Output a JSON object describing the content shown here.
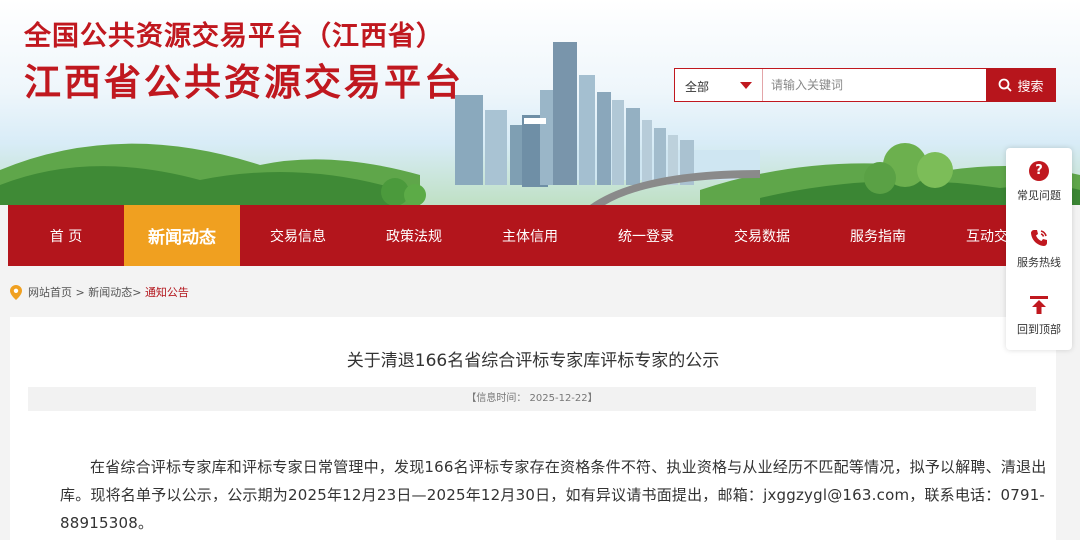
{
  "header": {
    "title_line1": "全国公共资源交易平台（江西省）",
    "title_line2": "江西省公共资源交易平台"
  },
  "search": {
    "select_value": "全部",
    "placeholder": "请输入关键词",
    "button_label": "搜索"
  },
  "nav": {
    "items": [
      {
        "label": "首 页"
      },
      {
        "label": "新闻动态"
      },
      {
        "label": "交易信息"
      },
      {
        "label": "政策法规"
      },
      {
        "label": "主体信用"
      },
      {
        "label": "统一登录"
      },
      {
        "label": "交易数据"
      },
      {
        "label": "服务指南"
      },
      {
        "label": "互动交流"
      }
    ]
  },
  "breadcrumb": {
    "home": "网站首页",
    "sep": ">",
    "level1": "新闻动态>",
    "current": "通知公告"
  },
  "article": {
    "title": "关于清退166名省综合评标专家库评标专家的公示",
    "meta": "【信息时间： 2025-12-22】",
    "body": "在省综合评标专家库和评标专家日常管理中，发现166名评标专家存在资格条件不符、执业资格与从业经历不匹配等情况，拟予以解聘、清退出库。现将名单予以公示，公示期为2025年12月23日—2025年12月30日，如有异议请书面提出，邮箱：jxggzygl@163.com，联系电话：0791-88915308。"
  },
  "side": {
    "faq": "常见问题",
    "hotline": "服务热线",
    "top": "回到顶部",
    "faq_symbol": "?"
  },
  "colors": {
    "brand_red": "#b3151c",
    "active_orange": "#f0a020"
  }
}
